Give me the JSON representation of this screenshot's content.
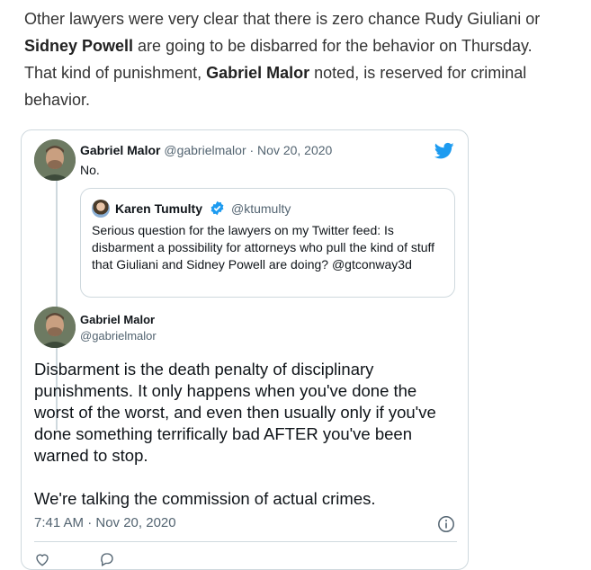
{
  "article": {
    "seg1": "Other lawyers were very clear that there is zero chance Rudy Giuliani or ",
    "name1": "Sidney Powell",
    "seg2": " are going to be disbarred for the behavior on Thursday. That kind of punishment, ",
    "name2": "Gabriel Malor",
    "seg3": " noted, is reserved for criminal behavior."
  },
  "tweet1": {
    "author_name": "Gabriel Malor",
    "handle_date": "@gabrielmalor · Nov 20, 2020",
    "text": "No."
  },
  "quoted": {
    "author_name": "Karen Tumulty",
    "handle": "@ktumulty",
    "text": "Serious question for the lawyers on my Twitter feed: Is disbarment a possibility for attorneys who pull the kind of stuff that Giuliani and Sidney Powell are doing? @gtconway3d"
  },
  "tweet2": {
    "author_name": "Gabriel Malor",
    "handle": "@gabrielmalor",
    "para1": "Disbarment is the death penalty of disciplinary punishments. It only happens when you've done the worst of the worst, and even then usually only if you've done something terrifically bad AFTER you've been warned to stop.",
    "para2": "We're talking the commission of actual crimes.",
    "timestamp": "7:41 AM · Nov 20, 2020"
  },
  "colors": {
    "twitter_blue": "#1d9bf0",
    "border": "#cfd9de",
    "muted": "#536471"
  },
  "icons": [
    "twitter-bird-icon",
    "verified-badge-icon",
    "info-icon",
    "heart-icon",
    "reply-icon"
  ]
}
